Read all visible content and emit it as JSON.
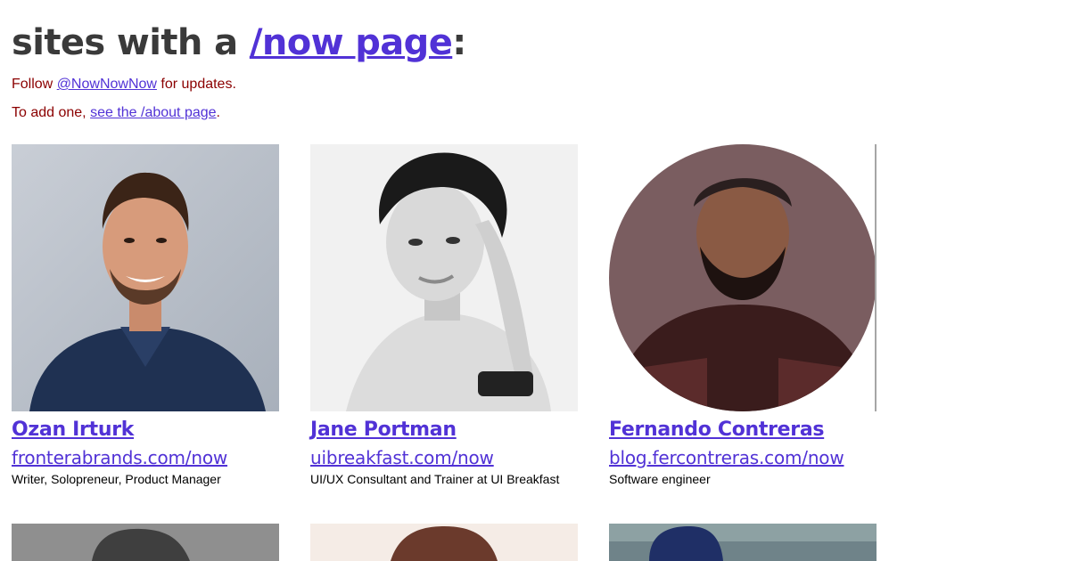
{
  "header": {
    "title_prefix": "sites with a ",
    "title_link": "/now page",
    "title_suffix": ":",
    "follow_prefix": "Follow ",
    "follow_link": "@NowNowNow",
    "follow_suffix": " for updates.",
    "add_prefix": "To add one, ",
    "add_link": "see the /about page",
    "add_suffix": "."
  },
  "profiles": [
    {
      "name": "Ozan Irturk",
      "url": "fronterabrands.com/now",
      "description": "Writer, Solopreneur, Product Manager"
    },
    {
      "name": "Jane Portman",
      "url": "uibreakfast.com/now",
      "description": "UI/UX Consultant and Trainer at UI Breakfast"
    },
    {
      "name": "Fernando Contreras",
      "url": "blog.fercontreras.com/now",
      "description": "Software engineer"
    }
  ],
  "colors": {
    "link": "#5132d6",
    "heading": "#3a3a3a",
    "note": "#8b0000"
  }
}
